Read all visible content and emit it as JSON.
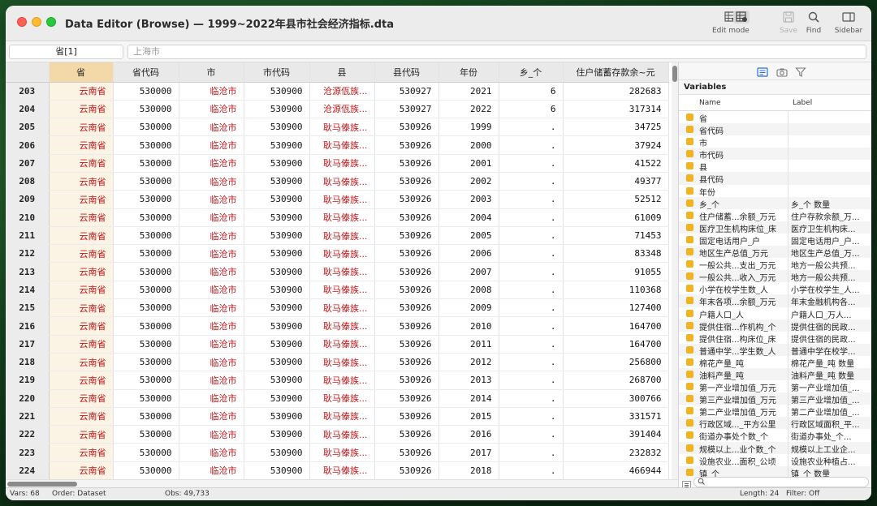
{
  "window": {
    "title": "Data Editor (Browse) — 1999~2022年县市社会经济指标.dta"
  },
  "toolbar": {
    "edit_mode": "Edit mode",
    "save": "Save",
    "find": "Find",
    "sidebar": "Sidebar"
  },
  "command_bar": {
    "varname": "省[1]",
    "value": "上海市"
  },
  "grid": {
    "columns": [
      "省",
      "省代码",
      "市",
      "市代码",
      "县",
      "县代码",
      "年份",
      "乡_个",
      "住户储蓄存款余~元"
    ],
    "rows": [
      {
        "n": "203",
        "c": [
          "云南省",
          "530000",
          "临沧市",
          "530900",
          "沧源佤族...",
          "530927",
          "2021",
          "6",
          "282683"
        ]
      },
      {
        "n": "204",
        "c": [
          "云南省",
          "530000",
          "临沧市",
          "530900",
          "沧源佤族...",
          "530927",
          "2022",
          "6",
          "317314"
        ]
      },
      {
        "n": "205",
        "c": [
          "云南省",
          "530000",
          "临沧市",
          "530900",
          "耿马傣族...",
          "530926",
          "1999",
          ".",
          "34725"
        ]
      },
      {
        "n": "206",
        "c": [
          "云南省",
          "530000",
          "临沧市",
          "530900",
          "耿马傣族...",
          "530926",
          "2000",
          ".",
          "37924"
        ]
      },
      {
        "n": "207",
        "c": [
          "云南省",
          "530000",
          "临沧市",
          "530900",
          "耿马傣族...",
          "530926",
          "2001",
          ".",
          "41522"
        ]
      },
      {
        "n": "208",
        "c": [
          "云南省",
          "530000",
          "临沧市",
          "530900",
          "耿马傣族...",
          "530926",
          "2002",
          ".",
          "49377"
        ]
      },
      {
        "n": "209",
        "c": [
          "云南省",
          "530000",
          "临沧市",
          "530900",
          "耿马傣族...",
          "530926",
          "2003",
          ".",
          "52512"
        ]
      },
      {
        "n": "210",
        "c": [
          "云南省",
          "530000",
          "临沧市",
          "530900",
          "耿马傣族...",
          "530926",
          "2004",
          ".",
          "61009"
        ]
      },
      {
        "n": "211",
        "c": [
          "云南省",
          "530000",
          "临沧市",
          "530900",
          "耿马傣族...",
          "530926",
          "2005",
          ".",
          "71453"
        ]
      },
      {
        "n": "212",
        "c": [
          "云南省",
          "530000",
          "临沧市",
          "530900",
          "耿马傣族...",
          "530926",
          "2006",
          ".",
          "83348"
        ]
      },
      {
        "n": "213",
        "c": [
          "云南省",
          "530000",
          "临沧市",
          "530900",
          "耿马傣族...",
          "530926",
          "2007",
          ".",
          "91055"
        ]
      },
      {
        "n": "214",
        "c": [
          "云南省",
          "530000",
          "临沧市",
          "530900",
          "耿马傣族...",
          "530926",
          "2008",
          ".",
          "110368"
        ]
      },
      {
        "n": "215",
        "c": [
          "云南省",
          "530000",
          "临沧市",
          "530900",
          "耿马傣族...",
          "530926",
          "2009",
          ".",
          "127400"
        ]
      },
      {
        "n": "216",
        "c": [
          "云南省",
          "530000",
          "临沧市",
          "530900",
          "耿马傣族...",
          "530926",
          "2010",
          ".",
          "164700"
        ]
      },
      {
        "n": "217",
        "c": [
          "云南省",
          "530000",
          "临沧市",
          "530900",
          "耿马傣族...",
          "530926",
          "2011",
          ".",
          "164700"
        ]
      },
      {
        "n": "218",
        "c": [
          "云南省",
          "530000",
          "临沧市",
          "530900",
          "耿马傣族...",
          "530926",
          "2012",
          ".",
          "256800"
        ]
      },
      {
        "n": "219",
        "c": [
          "云南省",
          "530000",
          "临沧市",
          "530900",
          "耿马傣族...",
          "530926",
          "2013",
          ".",
          "268700"
        ]
      },
      {
        "n": "220",
        "c": [
          "云南省",
          "530000",
          "临沧市",
          "530900",
          "耿马傣族...",
          "530926",
          "2014",
          ".",
          "300766"
        ]
      },
      {
        "n": "221",
        "c": [
          "云南省",
          "530000",
          "临沧市",
          "530900",
          "耿马傣族...",
          "530926",
          "2015",
          ".",
          "331571"
        ]
      },
      {
        "n": "222",
        "c": [
          "云南省",
          "530000",
          "临沧市",
          "530900",
          "耿马傣族...",
          "530926",
          "2016",
          ".",
          "391404"
        ]
      },
      {
        "n": "223",
        "c": [
          "云南省",
          "530000",
          "临沧市",
          "530900",
          "耿马傣族...",
          "530926",
          "2017",
          ".",
          "232832"
        ]
      },
      {
        "n": "224",
        "c": [
          "云南省",
          "530000",
          "临沧市",
          "530900",
          "耿马傣族...",
          "530926",
          "2018",
          ".",
          "466944"
        ]
      }
    ]
  },
  "variables_panel": {
    "title": "Variables",
    "col_name": "Name",
    "col_label": "Label",
    "items": [
      {
        "name": "省",
        "label": ""
      },
      {
        "name": "省代码",
        "label": ""
      },
      {
        "name": "市",
        "label": ""
      },
      {
        "name": "市代码",
        "label": ""
      },
      {
        "name": "县",
        "label": ""
      },
      {
        "name": "县代码",
        "label": ""
      },
      {
        "name": "年份",
        "label": ""
      },
      {
        "name": "乡_个",
        "label": "乡_个 数量"
      },
      {
        "name": "住户储蓄...余额_万元",
        "label": "住户存款余额_万..."
      },
      {
        "name": "医疗卫生机构床位_床",
        "label": "医疗卫生机构床..."
      },
      {
        "name": "固定电话用户_户",
        "label": "固定电话用户_户..."
      },
      {
        "name": "地区生产总值_万元",
        "label": "地区生产总值_万..."
      },
      {
        "name": "一般公共...支出_万元",
        "label": "地方一般公共预..."
      },
      {
        "name": "一般公共...收入_万元",
        "label": "地方一般公共预..."
      },
      {
        "name": "小学在校学生数_人",
        "label": "小学在校学生_人..."
      },
      {
        "name": "年末各项...余额_万元",
        "label": "年末金融机构各..."
      },
      {
        "name": "户籍人口_人",
        "label": "户籍人口_万人..."
      },
      {
        "name": "提供住宿...作机构_个",
        "label": "提供住宿的民政..."
      },
      {
        "name": "提供住宿...构床位_床",
        "label": "提供住宿的民政..."
      },
      {
        "name": "普通中学...学生数_人",
        "label": "普通中学在校学..."
      },
      {
        "name": "棉花产量_吨",
        "label": "棉花产量_吨 数量"
      },
      {
        "name": "油料产量_吨",
        "label": "油料产量_吨 数量"
      },
      {
        "name": "第一产业增加值_万元",
        "label": "第一产业增加值_..."
      },
      {
        "name": "第三产业增加值_万元",
        "label": "第三产业增加值_..."
      },
      {
        "name": "第二产业增加值_万元",
        "label": "第二产业增加值_..."
      },
      {
        "name": "行政区域..._平方公里",
        "label": "行政区域面积_平..."
      },
      {
        "name": "街道办事处个数_个",
        "label": "街道办事处_个..."
      },
      {
        "name": "规模以上...业个数_个",
        "label": "规模以上工业企..."
      },
      {
        "name": "设施农业...面积_公顷",
        "label": "设施农业种植占..."
      },
      {
        "name": "镇_个",
        "label": "镇_个 数量"
      }
    ]
  },
  "status": {
    "vars": "Vars: 68",
    "order": "Order: Dataset",
    "obs": "Obs: 49,733",
    "length": "Length: 24",
    "filter": "Filter: Off"
  },
  "colors": {
    "string_value": "#c0161a",
    "selected_header": "#f3d9a8",
    "var_checkbox": "#f1b321"
  }
}
